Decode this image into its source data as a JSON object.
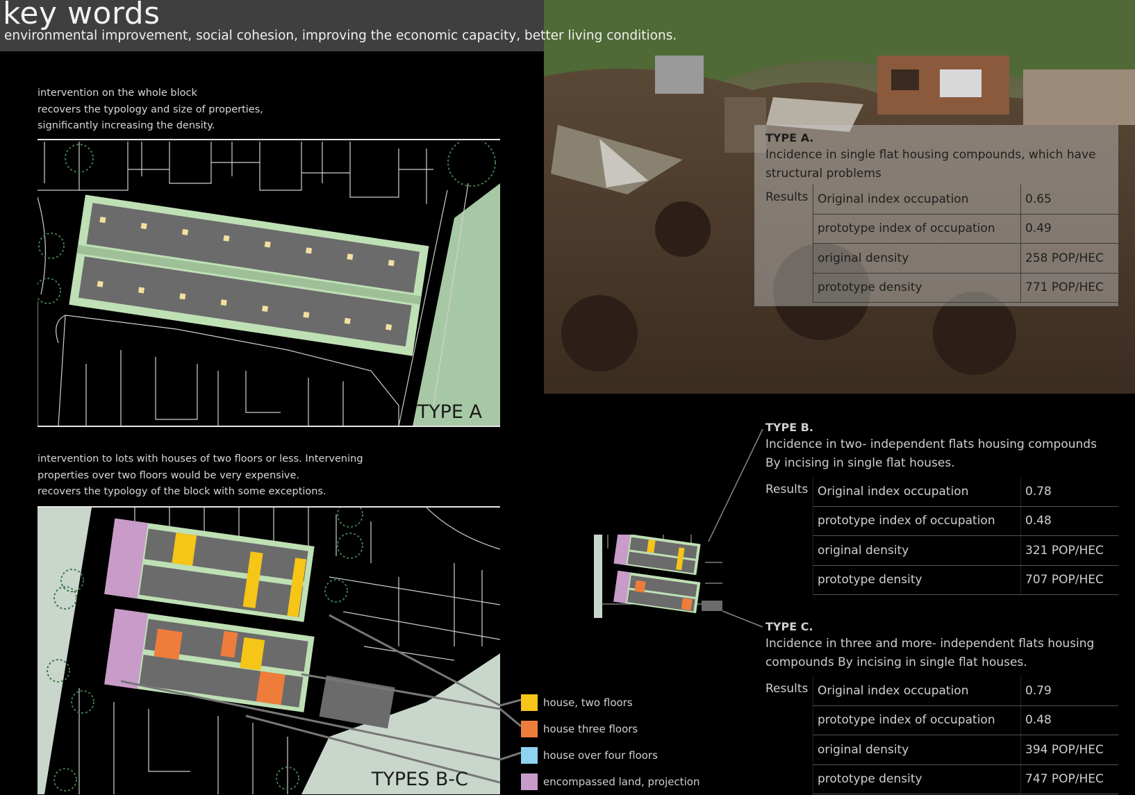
{
  "header": {
    "title": "key words",
    "keywords": "environmental improvement, social cohesion, improving the economic capacity, better living conditions."
  },
  "type_a_text": {
    "lines": [
      "intervention on the whole block",
      "recovers the typology and size of properties,",
      "significantly increasing the density."
    ]
  },
  "type_bc_text": {
    "lines": [
      "intervention to lots with houses of two floors or less. Intervening",
      "properties over two floors would be very expensive.",
      "recovers the typology of the block with some exceptions."
    ]
  },
  "map_labels": {
    "type_a": "TYPE A",
    "types_bc": "TYPES B-C"
  },
  "results_label": "Results",
  "types": [
    {
      "title": "TYPE A.",
      "incidence": [
        "Incidence in single flat housing compounds, which have",
        "structural problems"
      ],
      "rows": [
        {
          "name": "Original index occupation",
          "value": "0.65"
        },
        {
          "name": "prototype index of occupation",
          "value": "0.49"
        },
        {
          "name": "original density",
          "value": "258 POP/HEC"
        },
        {
          "name": "prototype density",
          "value": "771 POP/HEC"
        }
      ]
    },
    {
      "title": "TYPE B.",
      "incidence": [
        "Incidence in two- independent flats housing compounds",
        "By incising in single flat houses."
      ],
      "rows": [
        {
          "name": "Original index occupation",
          "value": "0.78"
        },
        {
          "name": "prototype index of occupation",
          "value": "0.48"
        },
        {
          "name": "original density",
          "value": "321 POP/HEC"
        },
        {
          "name": "prototype density",
          "value": "707 POP/HEC"
        }
      ]
    },
    {
      "title": "TYPE C.",
      "incidence": [
        "Incidence in three and more- independent flats housing",
        "compounds    By incising in single flat houses."
      ],
      "rows": [
        {
          "name": "Original index occupation",
          "value": "0.79"
        },
        {
          "name": "prototype index of occupation",
          "value": "0.48"
        },
        {
          "name": "original density",
          "value": "394 POP/HEC"
        },
        {
          "name": "prototype density",
          "value": "747 POP/HEC"
        }
      ]
    }
  ],
  "legend": [
    {
      "label": "house, two floors",
      "color": "#f5c518"
    },
    {
      "label": "house three floors",
      "color": "#ee7d3c"
    },
    {
      "label": "house over four floors",
      "color": "#8fd3f2"
    },
    {
      "label": "encompassed land, projection",
      "color": "#c99bc9"
    }
  ],
  "colors": {
    "park": "#a7c8a4",
    "roof": "#6b6b6b",
    "block_border": "#bfe0b5",
    "tree": "#3f7a4a"
  }
}
